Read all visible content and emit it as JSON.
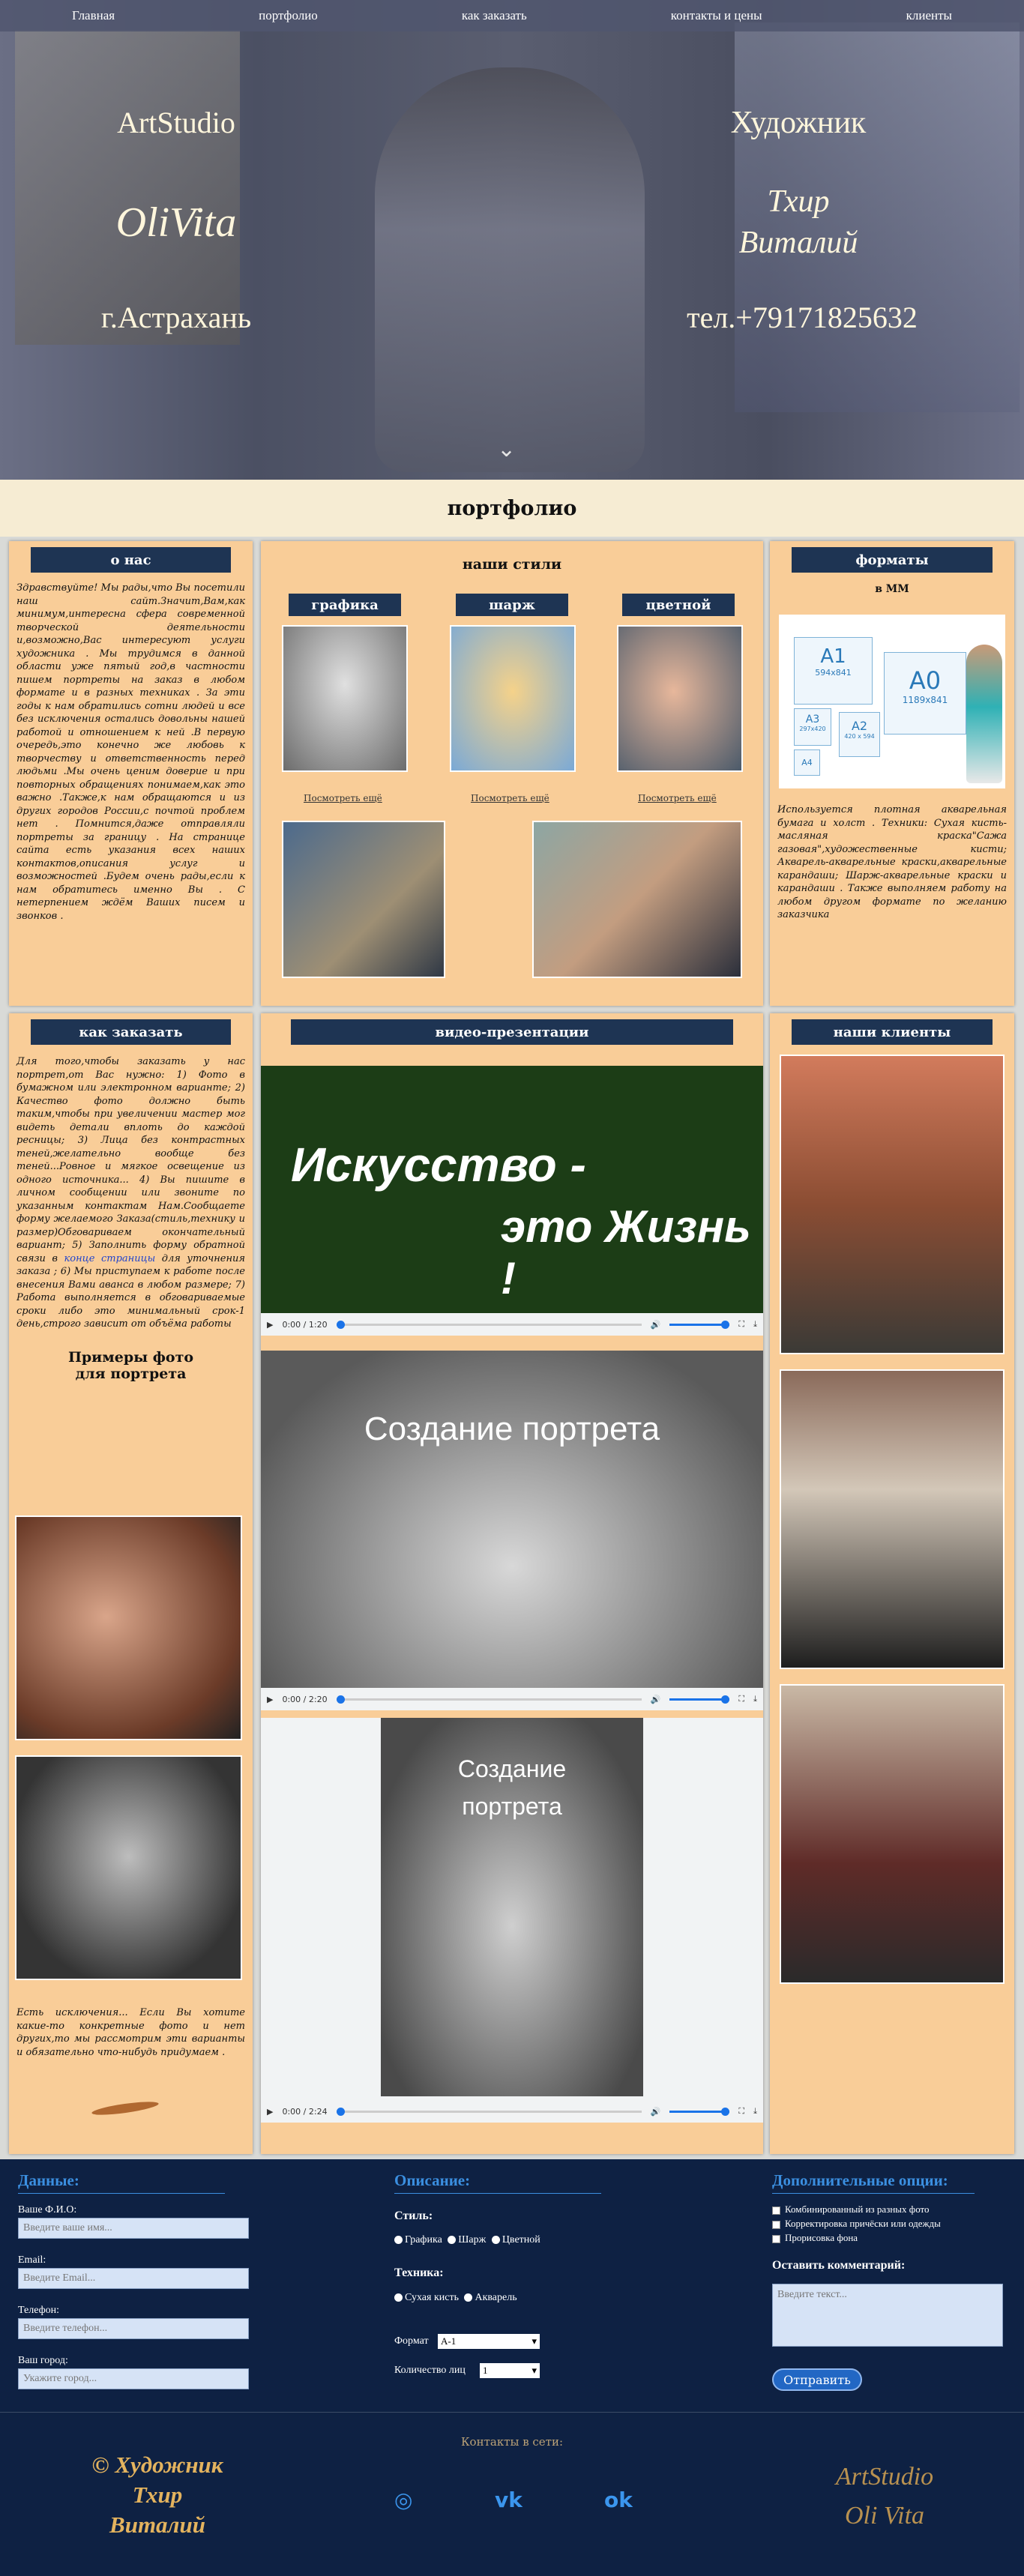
{
  "nav": [
    "Главная",
    "портфолио",
    "как заказать",
    "контакты и цены",
    "клиенты"
  ],
  "hero": {
    "studio": "ArtStudio",
    "brand": "OliVita",
    "city": "г.Астрахань",
    "role": "Художник",
    "name_first": "Тхир",
    "name_last": "Виталий",
    "phone": "тел.+79171825632",
    "arrow": "⌄"
  },
  "portfolio_title": "портфолио",
  "about": {
    "title": "о нас",
    "text": "Здравствуйте! Мы рады,что Вы посетили наш сайт.Значит,Вам,как минимум,интересна сфера современной творческой деятельности и,возможно,Вас интересуют услуги художника . Мы трудимся в данной области уже пятый год,в частности пишем портреты на заказ в любом формате и в разных техниках . За эти годы к нам обратились сотни людей и все без исключения остались довольны нашей работой и отношением к ней .В первую очередь,это конечно же любовь к творчеству и ответственность перед людьми .Мы очень ценим доверие и при повторных обращениях понимаем,как это важно .Также,к нам обращаются и из других городов России,с почтой проблем нет . Помнится,даже отправляли портреты за границу . На странице сайта есть указания всех наших контактов,описания услуг и возможностей .Будем очень рады,если к нам обратитесь именно Вы . С нетерпением ждём Ваших писем и звонков ."
  },
  "styles": {
    "title": "наши стили",
    "items": [
      {
        "label": "графика",
        "link": "Посмотреть ещё"
      },
      {
        "label": "шарж",
        "link": "Посмотреть ещё"
      },
      {
        "label": "цветной",
        "link": "Посмотреть ещё"
      }
    ]
  },
  "formats": {
    "title": "форматы",
    "unit": "в ММ",
    "a1": "A1",
    "a1_size": "594x841",
    "a0": "A0",
    "a0_size": "1189x841",
    "a2": "A2",
    "a2_size": "420 x 594",
    "a3": "A3",
    "a3_size": "297x420",
    "a4": "A4",
    "text": "Используется плотная акварельная бумага и холст . Техники: Сухая кисть-масляная краска\"Сажа газовая\",художественные кисти; Акварель-акварельные краски,акварельные карандаши; Шарж-акварельные краски и карандаши . Также выполняем работу на любом другом формате по желанию заказчика"
  },
  "howto": {
    "title": "как заказать",
    "text_before": "Для того,чтобы заказать у нас портрет,от Вас нужно: 1) Фото в бумажном или электронном варианте; 2) Качество фото должно быть таким,чтобы при увеличении мастер мог видеть детали вплоть до каждой ресницы; 3) Лица без контрастных теней,желательно вообще без теней...Ровное и мягкое освещение из одного источника... 4) Вы пишите в личном сообщении или звоните по указанным контактам Нам.Сообщаете форму желаемого Заказа(стиль,технику и размер)Обговариваем окончательный вариант; 5) Заполнить форму обратной связи в ",
    "link": "конце страницы",
    "text_after": " для уточнения заказа ; 6) Мы приступаем к работе после внесения Вами аванса в любом размере; 7) Работа выполняется в обговариваемые сроки либо это минимальный срок-1 день,строго зависит от объёма работы",
    "examples_title_1": "Примеры фото",
    "examples_title_2": "для портрета",
    "exceptions": "Есть исключения... Если Вы хотите какие-то конкретные фото и нет других,то мы рассмотрим эти варианты и обязательно что-нибудь придумаем ."
  },
  "videos": {
    "title": "видео-презентации",
    "v1_line1": "Искусство -",
    "v1_line2": "это Жизнь !",
    "v1_time": "0:00 / 1:20",
    "v2_text": "Создание портрета",
    "v2_time": "0:00 / 2:20",
    "v3_text_1": "Создание",
    "v3_text_2": "портрета",
    "v3_time": "0:00 / 2:24"
  },
  "clients": {
    "title": "наши клиенты"
  },
  "form": {
    "data_title": "Данные:",
    "fio_label": "Ваше Ф.И.О:",
    "fio_placeholder": "Введите ваше имя...",
    "email_label": "Email:",
    "email_placeholder": "Введите Email...",
    "phone_label": "Телефон:",
    "phone_placeholder": "Введите телефон...",
    "city_label": "Ваш город:",
    "city_placeholder": "Укажите город...",
    "desc_title": "Описание:",
    "style_label": "Стиль:",
    "style_options": [
      "Графика",
      "Шарж",
      "Цветной"
    ],
    "tech_label": "Техника:",
    "tech_options": [
      "Сухая кисть",
      "Акварель"
    ],
    "format_label": "Формат",
    "format_value": "А-1",
    "persons_label": "Количество лиц",
    "persons_value": "1",
    "extra_title": "Дополнительные опции:",
    "extra_options": [
      "Комбинированный из разных фото",
      "Корректировка причёски или одежды",
      "Прорисовка фона"
    ],
    "comment_label": "Оставить комментарий:",
    "comment_placeholder": "Введите текст...",
    "send": "Отправить"
  },
  "footer": {
    "left_1": "© Художник",
    "left_2": "Тхир",
    "left_3": "Виталий",
    "contacts": "Контакты в сети:",
    "ig": "◎",
    "vk": "vk",
    "ok": "ok",
    "right_1": "ArtStudio",
    "right_2": "Oli Vita"
  },
  "colors": {
    "navy": "#1e3453",
    "panel": "#f9cd98",
    "footer": "#0e2143",
    "accent": "#3b8fe0",
    "gold": "#e3b35e"
  }
}
